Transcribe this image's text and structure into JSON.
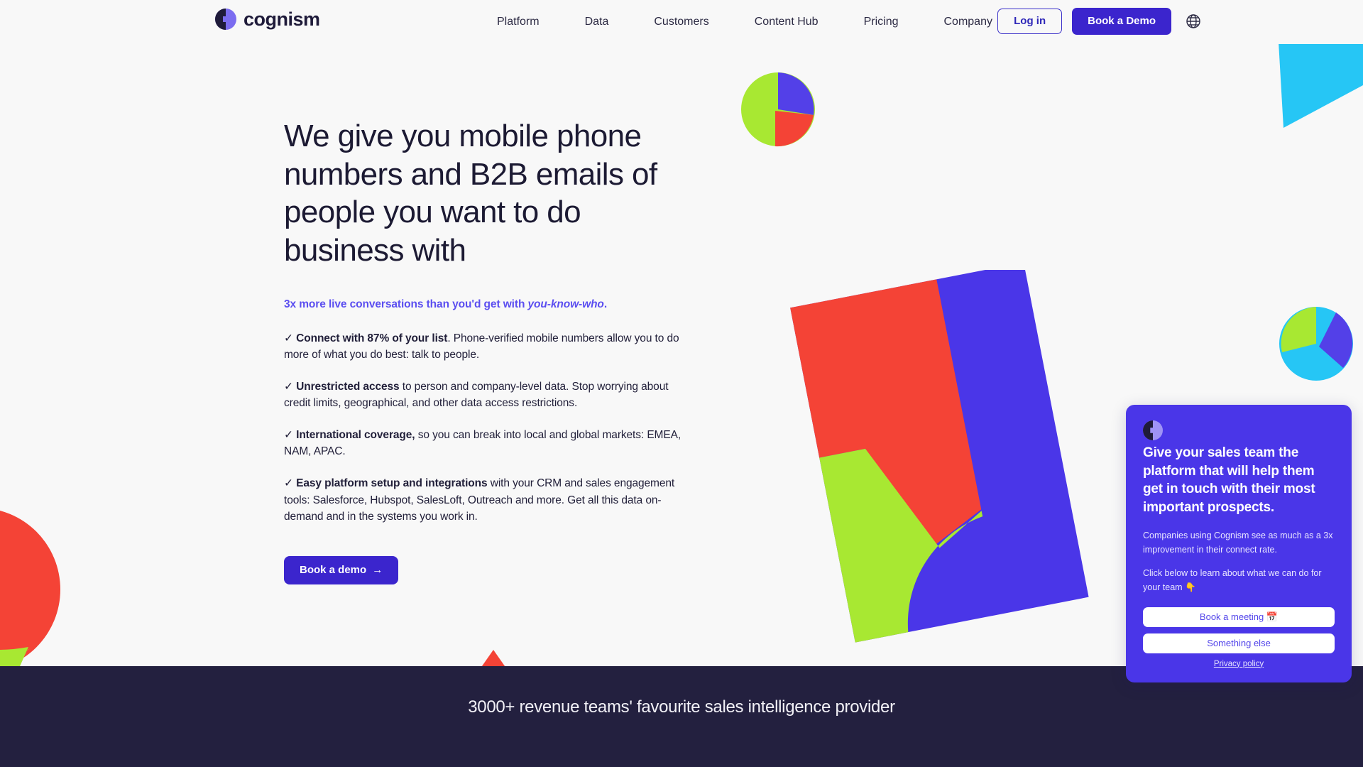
{
  "brand": {
    "name": "cognism",
    "logo_icon": "cognism-circle-logo",
    "accent_purple": "#3b25cd",
    "widget_purple": "#4a36e8",
    "link_purple": "#5b4ef0",
    "dark_navy": "#23203f",
    "red": "#f44336",
    "green": "#a8e832",
    "cyan": "#26c6f5",
    "blue": "#4a36e8",
    "page_bg": "#f8f8f8"
  },
  "header": {
    "nav_items": [
      {
        "label": "Platform"
      },
      {
        "label": "Data"
      },
      {
        "label": "Customers"
      },
      {
        "label": "Content Hub"
      },
      {
        "label": "Pricing"
      },
      {
        "label": "Company"
      }
    ],
    "login_label": "Log in",
    "demo_label": "Book a Demo",
    "language_icon": "globe-icon"
  },
  "hero": {
    "headline": "We give you mobile phone numbers and B2B emails of people you want to do business with",
    "subheadline_prefix": "3x more live conversations than you'd get with ",
    "subheadline_italic": "you-know-who",
    "subheadline_suffix": ".",
    "check_mark": "✓",
    "bullets": [
      {
        "bold": "Connect with 87% of your list",
        "rest": ". Phone-verified mobile numbers allow you to do more of what you do best: talk to people."
      },
      {
        "bold": "Unrestricted access",
        "rest": " to person and company-level data. Stop worrying about credit limits, geographical, and other data access restrictions."
      },
      {
        "bold": "International coverage,",
        "rest": " so you can break into local and global markets: EMEA, NAM, APAC."
      },
      {
        "bold": "Easy platform setup and integrations",
        "rest": " with your CRM and sales engagement tools: Salesforce, Hubspot, SalesLoft, Outreach and more. Get all this data on-demand and in the systems you work in."
      }
    ],
    "cta_label": "Book a demo",
    "cta_arrow": "→"
  },
  "chat_widget": {
    "logo_icon": "cognism-circle-logo",
    "title": "Give your sales team the platform that will help them get in touch with their most important prospects.",
    "paragraph_1": "Companies using Cognism see as much as a 3x improvement in their connect rate.",
    "paragraph_2": "Click below to learn about what we can do for your team 👇",
    "buttons": [
      {
        "label": "Book a meeting 📅"
      },
      {
        "label": "Something else"
      }
    ],
    "privacy_label": "Privacy policy"
  },
  "bottom_band": {
    "text": "3000+ revenue teams' favourite sales intelligence provider"
  }
}
